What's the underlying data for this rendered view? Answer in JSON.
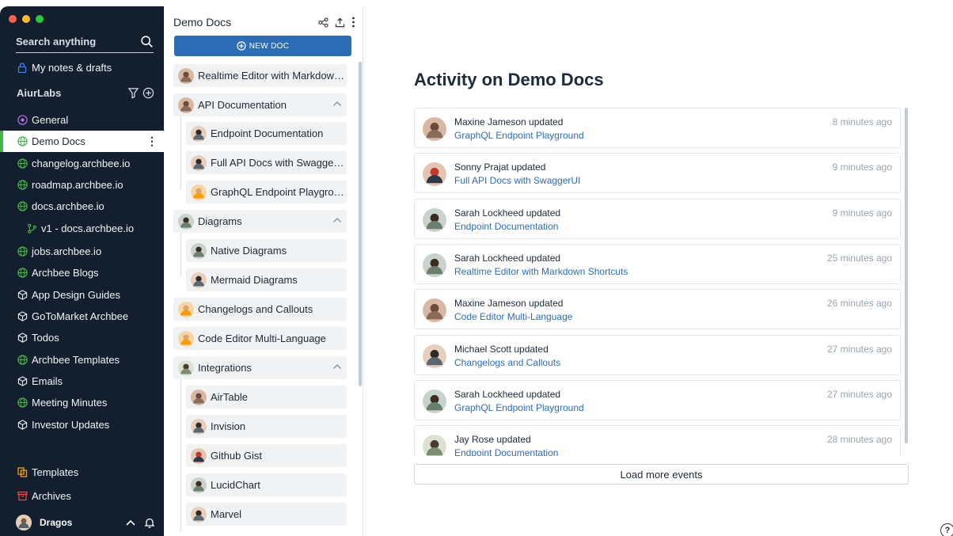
{
  "colors": {
    "sidebar_bg": "#131f2e",
    "accent_green": "#49b34b",
    "brand_blue": "#2d6db5",
    "link_blue": "#2d6db5"
  },
  "sidebar": {
    "search_placeholder": "Search anything",
    "my_notes": "My notes & drafts",
    "workspace": "AiurLabs",
    "items": [
      {
        "label": "General",
        "icon": "circle-dot-icon"
      },
      {
        "label": "Demo Docs",
        "icon": "globe-icon"
      },
      {
        "label": "changelog.archbee.io",
        "icon": "globe-icon"
      },
      {
        "label": "roadmap.archbee.io",
        "icon": "globe-icon"
      },
      {
        "label": "docs.archbee.io",
        "icon": "globe-icon"
      },
      {
        "label": "v1 - docs.archbee.io",
        "icon": "branch-icon"
      },
      {
        "label": "jobs.archbee.io",
        "icon": "globe-icon"
      },
      {
        "label": "Archbee Blogs",
        "icon": "globe-icon"
      },
      {
        "label": "App Design Guides",
        "icon": "cube-icon"
      },
      {
        "label": "GoToMarket Archbee",
        "icon": "cube-icon"
      },
      {
        "label": "Todos",
        "icon": "cube-icon"
      },
      {
        "label": "Archbee Templates",
        "icon": "globe-icon"
      },
      {
        "label": "Emails",
        "icon": "cube-icon"
      },
      {
        "label": "Meeting Minutes",
        "icon": "globe-icon"
      },
      {
        "label": "Investor Updates",
        "icon": "cube-icon"
      }
    ],
    "templates": "Templates",
    "archives": "Archives",
    "user": "Dragos"
  },
  "tree": {
    "title": "Demo Docs",
    "new_doc": "NEW DOC",
    "items": [
      {
        "label": "Realtime Editor with Markdown...",
        "level": 0
      },
      {
        "label": "API Documentation",
        "level": 0,
        "expanded": true
      },
      {
        "label": "Endpoint Documentation",
        "level": 1
      },
      {
        "label": "Full API Docs with SwaggerUI",
        "level": 1
      },
      {
        "label": "GraphQL Endpoint Playgrou...",
        "level": 1
      },
      {
        "label": "Diagrams",
        "level": 0,
        "expanded": true
      },
      {
        "label": "Native Diagrams",
        "level": 1
      },
      {
        "label": "Mermaid Diagrams",
        "level": 1
      },
      {
        "label": "Changelogs and Callouts",
        "level": 0
      },
      {
        "label": "Code Editor Multi-Language",
        "level": 0
      },
      {
        "label": "Integrations",
        "level": 0,
        "expanded": true
      },
      {
        "label": "AirTable",
        "level": 1
      },
      {
        "label": "Invision",
        "level": 1
      },
      {
        "label": "Github Gist",
        "level": 1
      },
      {
        "label": "LucidChart",
        "level": 1
      },
      {
        "label": "Marvel",
        "level": 1
      }
    ]
  },
  "main": {
    "title": "Activity on Demo Docs",
    "events": [
      {
        "who": "Maxine Jameson updated",
        "doc": "GraphQL Endpoint Playground",
        "when": "8 minutes ago"
      },
      {
        "who": "Sonny Prajat updated",
        "doc": "Full API Docs with SwaggerUI",
        "when": "9 minutes ago"
      },
      {
        "who": "Sarah Lockheed updated",
        "doc": "Endpoint Documentation",
        "when": "9 minutes ago"
      },
      {
        "who": "Sarah Lockheed updated",
        "doc": "Realtime Editor with Markdown Shortcuts",
        "when": "25 minutes ago"
      },
      {
        "who": "Maxine Jameson updated",
        "doc": "Code Editor Multi-Language",
        "when": "26 minutes ago"
      },
      {
        "who": "Michael Scott updated",
        "doc": "Changelogs and Callouts",
        "when": "27 minutes ago"
      },
      {
        "who": "Sarah Lockheed updated",
        "doc": "GraphQL Endpoint Playground",
        "when": "27 minutes ago"
      },
      {
        "who": "Jay Rose updated",
        "doc": "Endpoint Documentation",
        "when": "28 minutes ago"
      }
    ],
    "load_more": "Load more events",
    "help": "?"
  }
}
